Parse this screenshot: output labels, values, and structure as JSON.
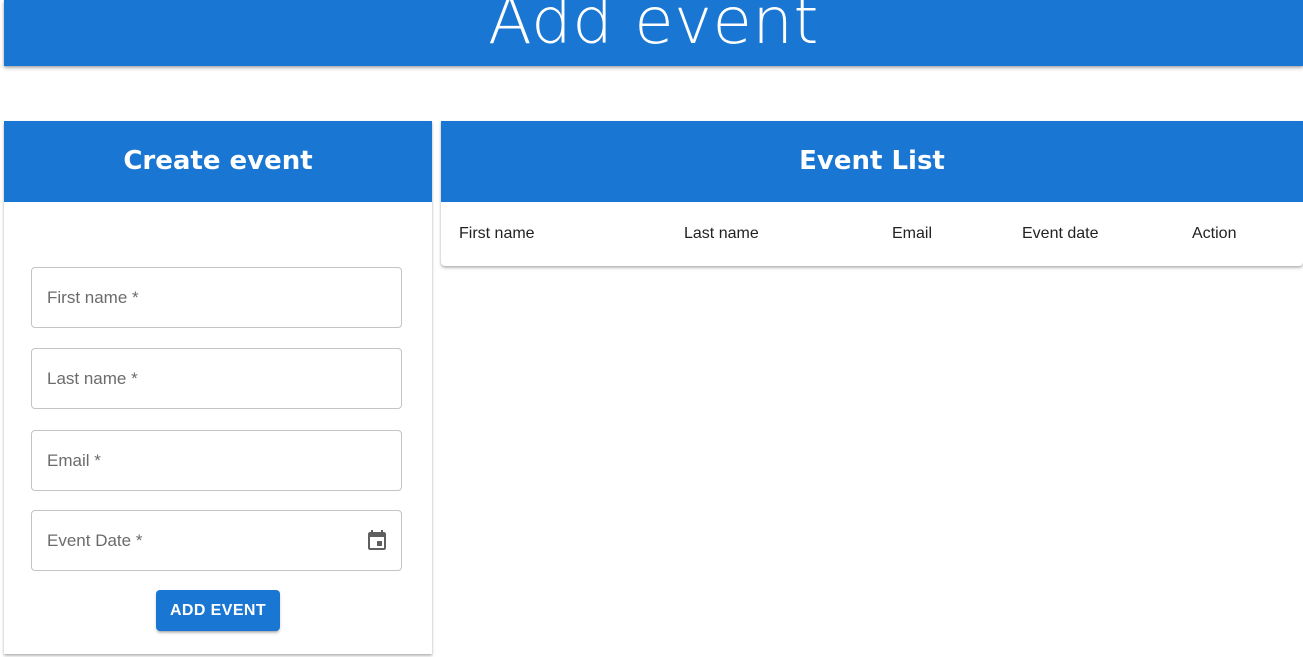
{
  "header": {
    "title": "Add event"
  },
  "create_card": {
    "title": "Create event",
    "fields": {
      "first_name": {
        "placeholder": "First name *",
        "value": ""
      },
      "last_name": {
        "placeholder": "Last name *",
        "value": ""
      },
      "email": {
        "placeholder": "Email *",
        "value": ""
      },
      "event_date": {
        "placeholder": "Event Date *",
        "value": "",
        "icon": "calendar-icon"
      }
    },
    "submit_label": "ADD EVENT"
  },
  "event_list": {
    "title": "Event List",
    "columns": [
      "First name",
      "Last name",
      "Email",
      "Event date",
      "Action"
    ],
    "rows": []
  },
  "colors": {
    "primary": "#1976d2",
    "field_border": "#c4c4c4",
    "label_text": "#6b6b6b"
  }
}
